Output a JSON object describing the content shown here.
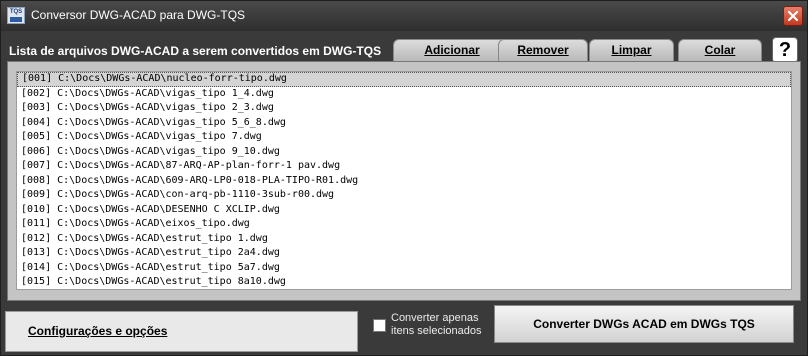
{
  "window": {
    "title": "Conversor DWG-ACAD para DWG-TQS",
    "icon_text": "TQS"
  },
  "list_title": "Lista de arquivos DWG-ACAD a serem convertidos em DWG-TQS",
  "tabs": [
    {
      "label": "Adicionar"
    },
    {
      "label": "Remover"
    },
    {
      "label": "Limpar"
    },
    {
      "label": "Colar"
    }
  ],
  "help_label": "?",
  "files": [
    "[001] C:\\Docs\\DWGs-ACAD\\nucleo-forr-tipo.dwg",
    "[002] C:\\Docs\\DWGs-ACAD\\vigas_tipo 1_4.dwg",
    "[003] C:\\Docs\\DWGs-ACAD\\vigas_tipo 2_3.dwg",
    "[004] C:\\Docs\\DWGs-ACAD\\vigas_tipo 5_6_8.dwg",
    "[005] C:\\Docs\\DWGs-ACAD\\vigas_tipo 7.dwg",
    "[006] C:\\Docs\\DWGs-ACAD\\vigas_tipo 9_10.dwg",
    "[007] C:\\Docs\\DWGs-ACAD\\87-ARQ-AP-plan-forr-1 pav.dwg",
    "[008] C:\\Docs\\DWGs-ACAD\\609-ARQ-LP0-018-PLA-TIPO-R01.dwg",
    "[009] C:\\Docs\\DWGs-ACAD\\con-arq-pb-1110-3sub-r00.dwg",
    "[010] C:\\Docs\\DWGs-ACAD\\DESENHO C XCLIP.dwg",
    "[011] C:\\Docs\\DWGs-ACAD\\eixos_tipo.dwg",
    "[012] C:\\Docs\\DWGs-ACAD\\estrut_tipo 1.dwg",
    "[013] C:\\Docs\\DWGs-ACAD\\estrut_tipo 2a4.dwg",
    "[014] C:\\Docs\\DWGs-ACAD\\estrut_tipo 5a7.dwg",
    "[015] C:\\Docs\\DWGs-ACAD\\estrut_tipo 8a10.dwg"
  ],
  "selected_index": 0,
  "config_link": "Configurações e opções",
  "convert_selected": {
    "label": "Converter apenas itens selecionados",
    "checked": false
  },
  "convert_button": "Converter DWGs ACAD em DWGs TQS",
  "colors": {
    "window_bg": "#3a3a3a",
    "close_button": "#c0391f",
    "list_panel": "#c4c4c4"
  }
}
